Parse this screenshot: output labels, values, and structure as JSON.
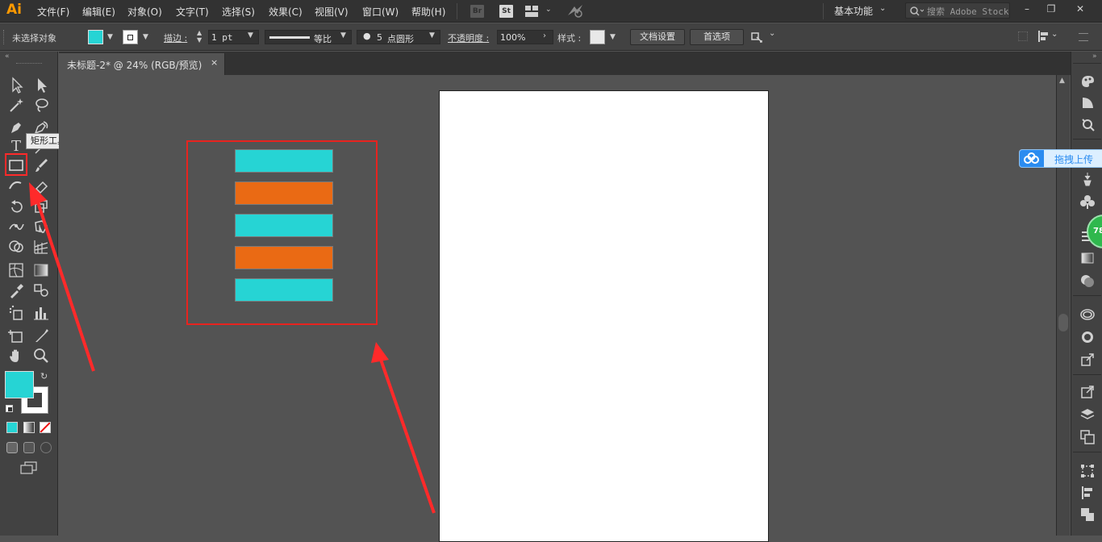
{
  "app": {
    "logo": "Ai"
  },
  "menu": [
    "文件(F)",
    "编辑(E)",
    "对象(O)",
    "文字(T)",
    "选择(S)",
    "效果(C)",
    "视图(V)",
    "窗口(W)",
    "帮助(H)"
  ],
  "bridge": {
    "br": "Br",
    "st": "St"
  },
  "workspace": {
    "label": "基本功能"
  },
  "search": {
    "placeholder": "搜索 Adobe Stock"
  },
  "window_controls": {
    "minimize": "–",
    "restore": "❐",
    "close": "✕"
  },
  "controlbar": {
    "selection_status": "未选择对象",
    "fill_color": "#26d4d4",
    "stroke_label": "描边 :",
    "stroke_weight": "1 pt",
    "stroke_profile": "等比",
    "brush_size": "5",
    "brush_name": "点圆形",
    "opacity_label": "不透明度 :",
    "opacity_value": "100%",
    "style_label": "样式 :",
    "doc_setup_button": "文档设置",
    "preferences_button": "首选项"
  },
  "tabs": [
    {
      "title": "未标题-2* @ 24% (RGB/预览)",
      "close": "×"
    }
  ],
  "tooltip": {
    "text": "矩形工具 (M)"
  },
  "colors": {
    "fill": "#26d4d4",
    "shape_cyan": "#26d4d4",
    "shape_orange": "#ea6a14",
    "annotation_red": "#e8231f"
  },
  "shapes": [
    "cyan",
    "orange",
    "cyan",
    "orange",
    "cyan"
  ],
  "upload_widget": {
    "label": "拖拽上传"
  },
  "badge": {
    "value": "78"
  }
}
